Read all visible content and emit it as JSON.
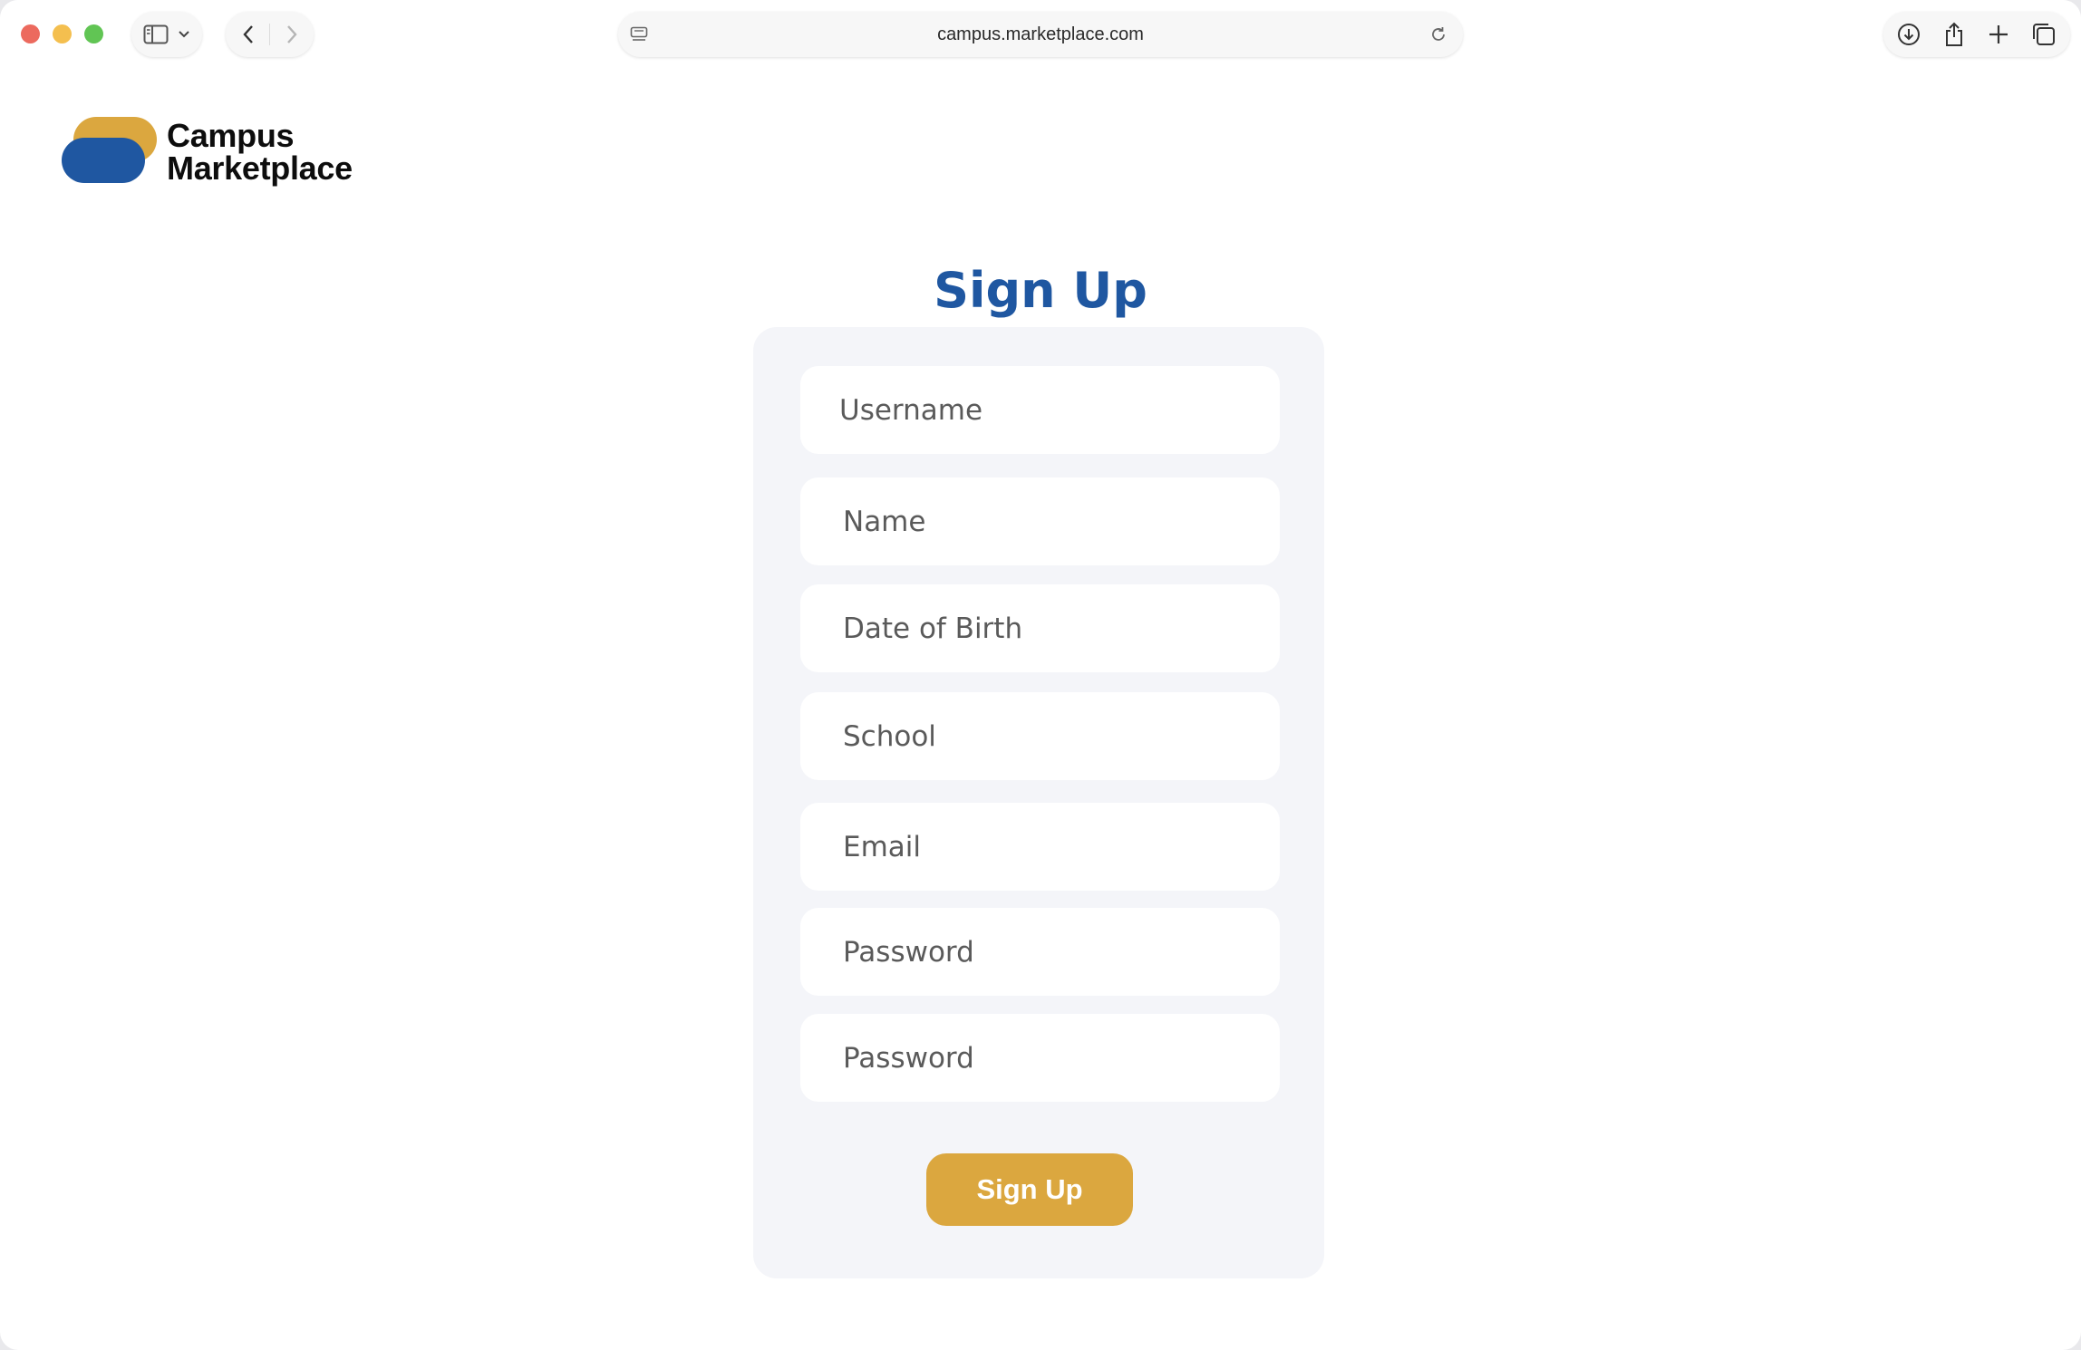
{
  "browser": {
    "url": "campus.marketplace.com",
    "icons": {
      "sidebar": "sidebar-icon",
      "chevron": "chevron-down-icon",
      "back": "back-icon",
      "forward": "forward-icon",
      "page_settings": "page-menu-icon",
      "reload": "reload-icon",
      "download": "download-icon",
      "share": "share-icon",
      "new_tab": "plus-icon",
      "tab_overview": "tabs-icon"
    }
  },
  "brand": {
    "line1": "Campus",
    "line2": "Marketplace",
    "colors": {
      "gold": "#dba73f",
      "blue": "#1f57a1"
    }
  },
  "form": {
    "title": "Sign Up",
    "fields": [
      {
        "placeholder": "Username"
      },
      {
        "placeholder": "Name"
      },
      {
        "placeholder": "Date of Birth"
      },
      {
        "placeholder": "School"
      },
      {
        "placeholder": "Email"
      },
      {
        "placeholder": "Password"
      },
      {
        "placeholder": "Password"
      }
    ],
    "submit_label": "Sign Up"
  },
  "colors": {
    "accent": "#dba73f",
    "title": "#1f57a1",
    "card_bg": "#f4f5f9"
  }
}
